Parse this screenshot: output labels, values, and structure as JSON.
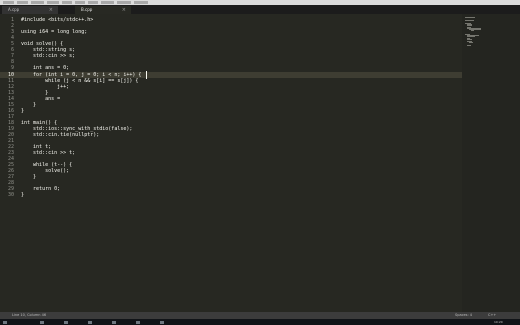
{
  "menu": [
    "File",
    "Edit",
    "Selection",
    "Find",
    "View",
    "Goto",
    "Tools",
    "Project",
    "Preferences",
    "Help"
  ],
  "tabs": [
    {
      "label": "A.cpp",
      "active": false
    },
    {
      "label": "B.cpp",
      "active": true
    }
  ],
  "editor": {
    "current_line": 10,
    "lines": [
      "#include <bits/stdc++.h>",
      "",
      "using i64 = long long;",
      "",
      "void solve() {",
      "    std::string s;",
      "    std::cin >> s;",
      "",
      "    int ans = 0;",
      "    for (int i = 0, j = 0; i < n; i++) {",
      "        while (j < n && s[i] == s[j]) {",
      "            j++;",
      "        }",
      "        ans =",
      "    }",
      "}",
      "",
      "int main() {",
      "    std::ios::sync_with_stdio(false);",
      "    std::cin.tie(nullptr);",
      "",
      "    int t;",
      "    std::cin >> t;",
      "",
      "    while (t--) {",
      "        solve();",
      "    }",
      "",
      "    return 0;",
      "}"
    ]
  },
  "status": {
    "left": "Line 10, Column 46",
    "spaces": "Spaces: 4",
    "syntax": "C++"
  },
  "taskbar": {
    "clock": "10:20"
  },
  "colors": {
    "background": "#272822",
    "keyword": "#f92672",
    "type": "#66d9ef",
    "function": "#a6e22e",
    "number": "#ae81ff",
    "string": "#e6db74"
  }
}
